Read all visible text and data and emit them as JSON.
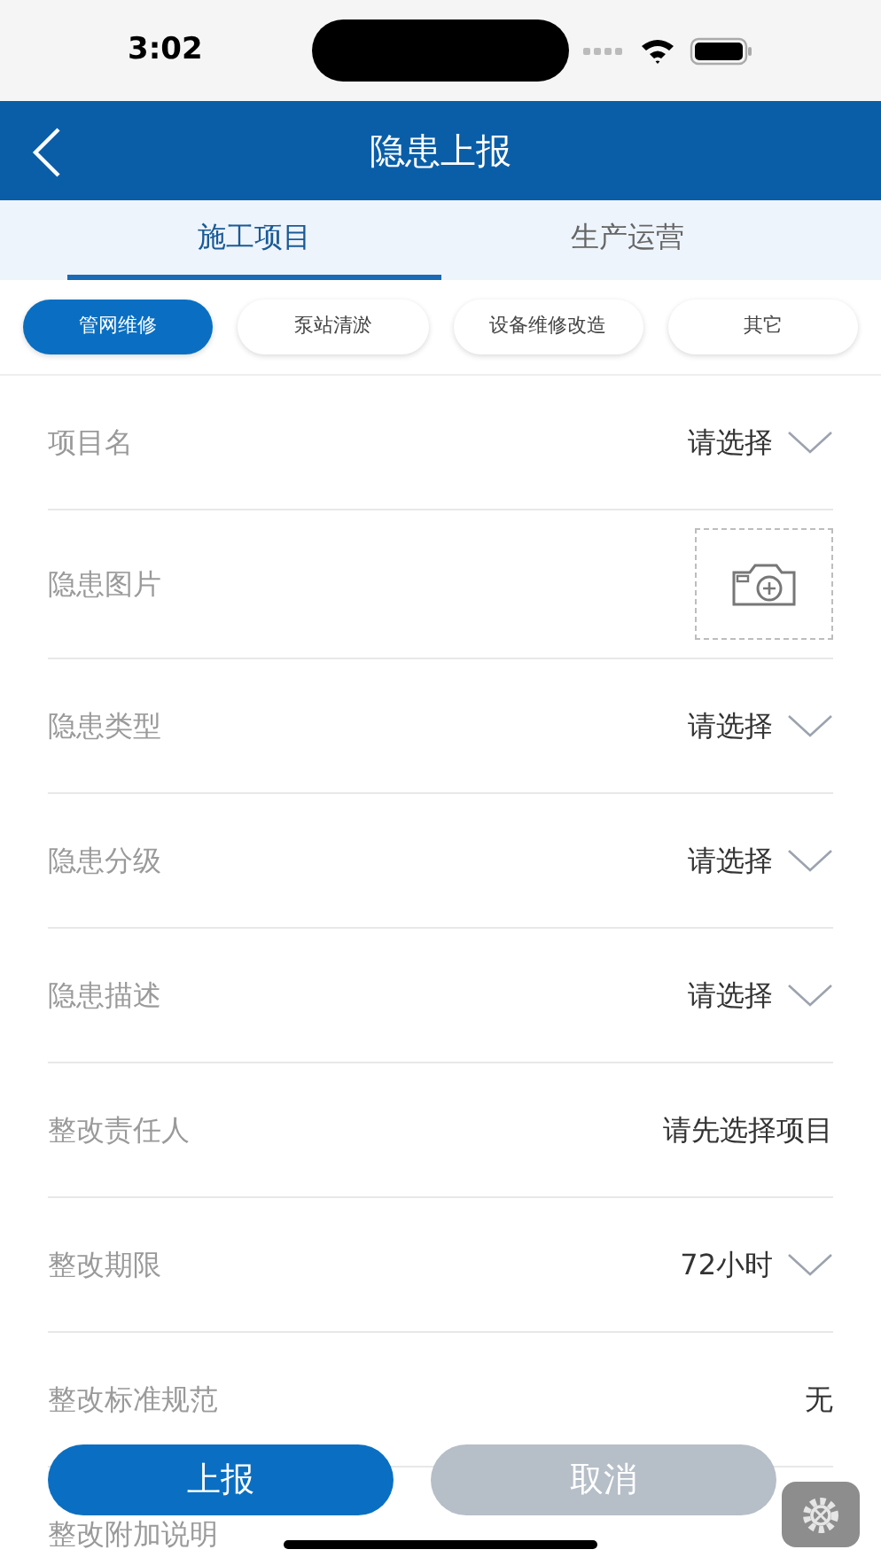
{
  "status_bar": {
    "time": "3:02"
  },
  "header": {
    "title": "隐患上报"
  },
  "tabs": [
    {
      "label": "施工项目",
      "selected": true
    },
    {
      "label": "生产运营",
      "selected": false
    }
  ],
  "chips": [
    {
      "label": "管网维修",
      "selected": true
    },
    {
      "label": "泵站清淤",
      "selected": false
    },
    {
      "label": "设备维修改造",
      "selected": false
    },
    {
      "label": "其它",
      "selected": false
    }
  ],
  "form_rows": [
    {
      "kind": "select",
      "label": "项目名",
      "value": "请选择"
    },
    {
      "kind": "photo",
      "label": "隐患图片"
    },
    {
      "kind": "select",
      "label": "隐患类型",
      "value": "请选择"
    },
    {
      "kind": "select",
      "label": "隐患分级",
      "value": "请选择"
    },
    {
      "kind": "select",
      "label": "隐患描述",
      "value": "请选择"
    },
    {
      "kind": "text",
      "label": "整改责任人",
      "value": "请先选择项目"
    },
    {
      "kind": "select",
      "label": "整改期限",
      "value": "72小时"
    },
    {
      "kind": "text",
      "label": "整改标准规范",
      "value": "无"
    },
    {
      "kind": "text",
      "label": "整改附加说明"
    }
  ],
  "actions": [
    {
      "label": "上报",
      "kind": "primary"
    },
    {
      "label": "取消",
      "kind": "secondary"
    }
  ]
}
